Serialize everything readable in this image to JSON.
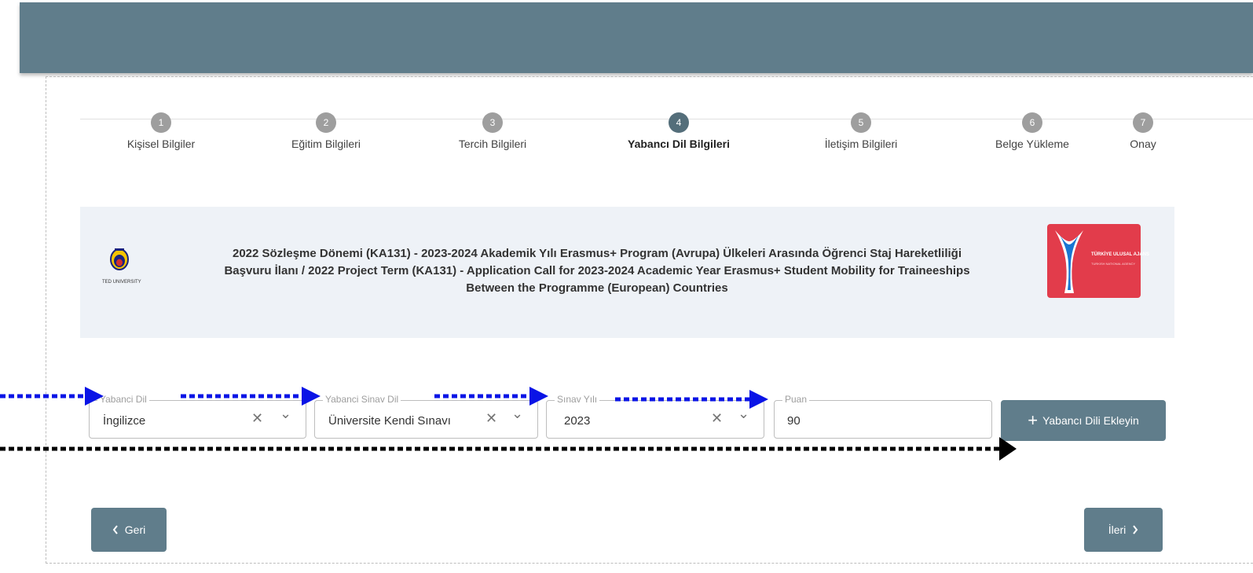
{
  "steps": [
    {
      "number": "1",
      "label": "Kişisel Bilgiler"
    },
    {
      "number": "2",
      "label": "Eğitim Bilgileri"
    },
    {
      "number": "3",
      "label": "Tercih Bilgileri"
    },
    {
      "number": "4",
      "label": "Yabancı Dil Bilgileri"
    },
    {
      "number": "5",
      "label": "İletişim Bilgileri"
    },
    {
      "number": "6",
      "label": "Belge Yükleme"
    },
    {
      "number": "7",
      "label": "Onay"
    }
  ],
  "banner": {
    "line1": "2022 Sözleşme Dönemi (KA131) - 2023-2024 Akademik Yılı Erasmus+ Program (Avrupa) Ülkeleri Arasında Öğrenci Staj Hareketliliği",
    "line2": "Başvuru İlanı / 2022 Project Term (KA131) - Application Call for 2023-2024 Academic Year Erasmus+ Student Mobility for Traineeships",
    "line3": "Between the Programme (European) Countries",
    "left_logo_caption": "TED UNIVERSITY",
    "right_logo_text": "TÜRKİYE ULUSAL AJANS",
    "right_logo_sub": "TURKISH NATIONAL AGENCY"
  },
  "form": {
    "language": {
      "label": "Yabanci Dil",
      "value": "İngilizce"
    },
    "exam_language": {
      "label": "Yabanci Sinav Dil",
      "value": "Üniversite Kendi Sınavı"
    },
    "exam_year": {
      "label": "Sınav Yılı",
      "value": "2023"
    },
    "score": {
      "label": "Puan",
      "value": "90"
    },
    "add_button": "Yabancı Dili Ekleyin",
    "clear_glyph": "✕",
    "chevron_glyph": "⌄"
  },
  "nav": {
    "back": "Geri",
    "next": "İleri"
  },
  "colors": {
    "header": "#607d8b",
    "active_step": "#546e7a",
    "inactive_step": "#9e9e9e",
    "banner_bg": "#eef2f7",
    "arrow_blue": "#0a14e6",
    "arrow_black": "#000000"
  }
}
